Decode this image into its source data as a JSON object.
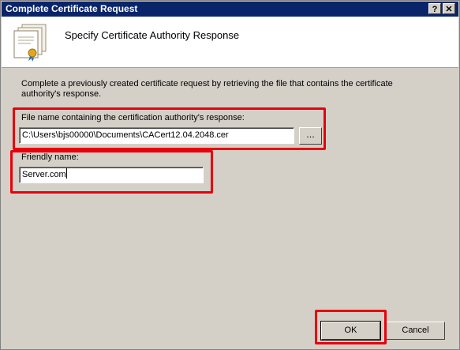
{
  "window": {
    "title": "Complete Certificate Request",
    "help_glyph": "?",
    "close_glyph": "✕"
  },
  "header": {
    "title": "Specify Certificate Authority Response",
    "icon": "certificate-icon"
  },
  "main": {
    "description": "Complete a previously created certificate request by retrieving the file that contains the certificate authority's response.",
    "file_label": "File name containing the certification authority's response:",
    "file_value": "C:\\Users\\bjs00000\\Documents\\CACert12.04.2048.cer",
    "browse_label": "...",
    "friendly_label": "Friendly name:",
    "friendly_value": "Server.com"
  },
  "buttons": {
    "ok_label": "OK",
    "cancel_label": "Cancel"
  },
  "colors": {
    "titlebar": "#0a246a",
    "dialog_background": "#d4d0c8",
    "highlight": "#e8000b"
  }
}
